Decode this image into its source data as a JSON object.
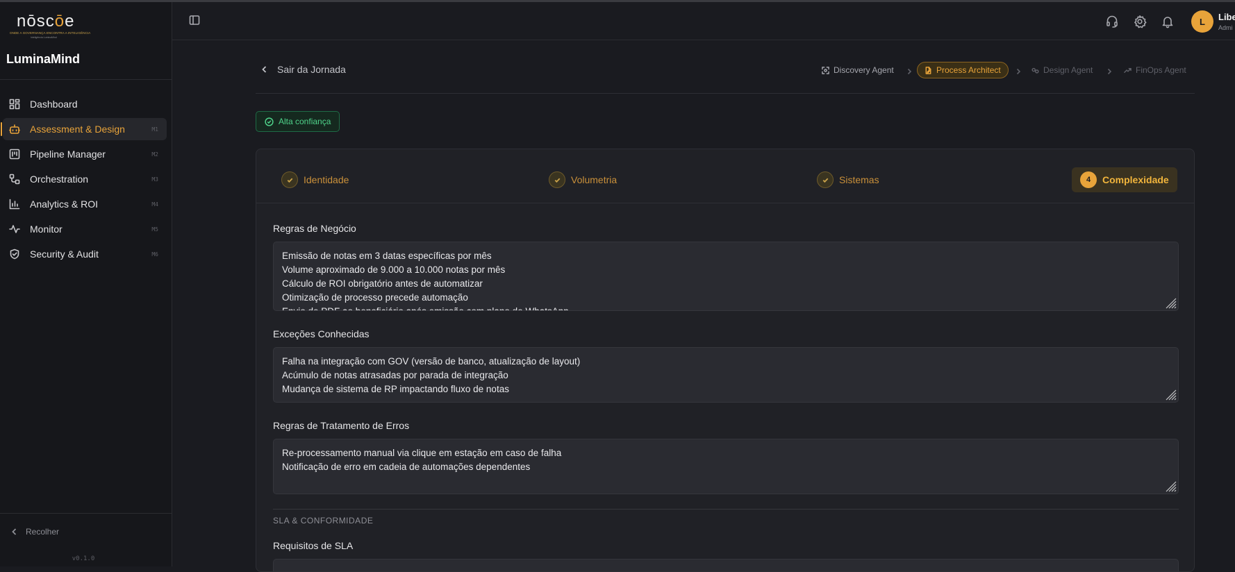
{
  "app": {
    "logo_text_pre": "nōsc",
    "logo_text_mid": "ō",
    "logo_text_post": "e",
    "logo_tagline": "ONDE A GOVERNANÇA ENCONTRA A INTELIGÊNCIA",
    "logo_tagline2": "Inteligência LuminaMind",
    "brand": "LuminaMind",
    "version": "v0.1.0"
  },
  "sidebar": {
    "items": [
      {
        "label": "Dashboard",
        "kbd": "",
        "icon": "dashboard-icon",
        "active": false
      },
      {
        "label": "Assessment & Design",
        "kbd": "M1",
        "icon": "robot-icon",
        "active": true
      },
      {
        "label": "Pipeline Manager",
        "kbd": "M2",
        "icon": "kanban-icon",
        "active": false
      },
      {
        "label": "Orchestration",
        "kbd": "M3",
        "icon": "workflow-icon",
        "active": false
      },
      {
        "label": "Analytics & ROI",
        "kbd": "M4",
        "icon": "bar-chart-icon",
        "active": false
      },
      {
        "label": "Monitor",
        "kbd": "M5",
        "icon": "activity-icon",
        "active": false
      },
      {
        "label": "Security & Audit",
        "kbd": "M6",
        "icon": "shield-icon",
        "active": false
      }
    ],
    "collapse_label": "Recolher"
  },
  "header": {
    "user_initial": "L",
    "user_name": "Libe",
    "user_role": "Admi"
  },
  "journey": {
    "back_label": "Sair da Jornada",
    "steps": [
      {
        "label": "Discovery Agent",
        "state": "done"
      },
      {
        "label": "Process Architect",
        "state": "active"
      },
      {
        "label": "Design Agent",
        "state": "pending"
      },
      {
        "label": "FinOps Agent",
        "state": "pending"
      }
    ],
    "confidence_badge": "Alta confiança"
  },
  "tabs": [
    {
      "label": "Identidade",
      "state": "done",
      "number": ""
    },
    {
      "label": "Volumetria",
      "state": "done",
      "number": ""
    },
    {
      "label": "Sistemas",
      "state": "done",
      "number": ""
    },
    {
      "label": "Complexidade",
      "state": "active",
      "number": "4"
    }
  ],
  "fields": {
    "business_rules": {
      "label": "Regras de Negócio",
      "lines": [
        "Emissão de notas em 3 datas específicas por mês",
        "Volume aproximado de 9.000 a 10.000 notas por mês",
        "Cálculo de ROI obrigatório antes de automatizar",
        "Otimização de processo precede automação",
        "Envio de PDF ao beneficiário após emissão com plano de WhatsApp"
      ]
    },
    "known_exceptions": {
      "label": "Exceções Conhecidas",
      "lines": [
        "Falha na integração com GOV (versão de banco, atualização de layout)",
        "Acúmulo de notas atrasadas por parada de integração",
        "Mudança de sistema de RP impactando fluxo de notas"
      ]
    },
    "error_handling": {
      "label": "Regras de Tratamento de Erros",
      "lines": [
        "Re-processamento manual via clique em estação em caso de falha",
        "Notificação de erro em cadeia de automações dependentes"
      ]
    },
    "section_title": "SLA & CONFORMIDADE",
    "sla_label": "Requisitos de SLA"
  },
  "colors": {
    "accent": "#e8a33a",
    "success": "#4fd38a",
    "background": "#1a1b20"
  }
}
